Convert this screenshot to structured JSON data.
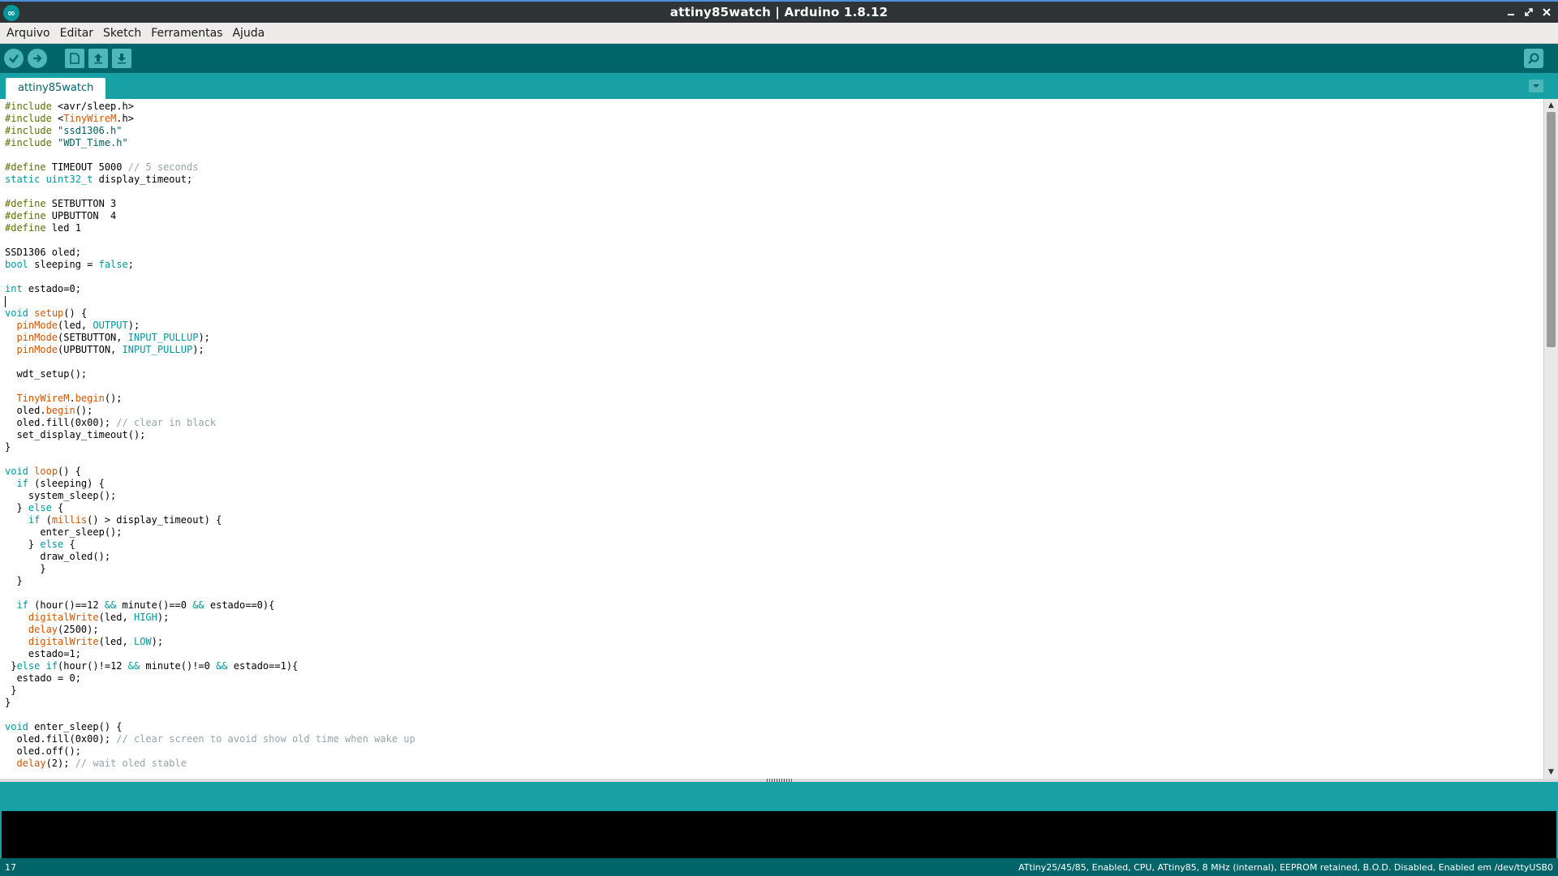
{
  "window": {
    "title": "attiny85watch | Arduino 1.8.12",
    "app_icon_label": "∞"
  },
  "menu": [
    "Arquivo",
    "Editar",
    "Sketch",
    "Ferramentas",
    "Ajuda"
  ],
  "toolbar": {
    "buttons": [
      "verify-icon",
      "upload-icon",
      "new-icon",
      "open-icon",
      "save-icon"
    ],
    "serial_monitor": "magnifier-icon"
  },
  "tabs": [
    {
      "label": "attiny85watch",
      "active": true
    }
  ],
  "editor": {
    "cursor_line": 17,
    "lines": [
      [
        [
          "p",
          "#include "
        ],
        [
          "n",
          "<avr/sleep.h>"
        ]
      ],
      [
        [
          "p",
          "#include "
        ],
        [
          "n",
          "<"
        ],
        [
          "f",
          "TinyWireM"
        ],
        [
          "n",
          ".h>"
        ]
      ],
      [
        [
          "p",
          "#include "
        ],
        [
          "s",
          "\"ssd1306.h\""
        ]
      ],
      [
        [
          "p",
          "#include "
        ],
        [
          "s",
          "\"WDT_Time.h\""
        ]
      ],
      [],
      [
        [
          "p",
          "#define "
        ],
        [
          "n",
          "TIMEOUT 5000 "
        ],
        [
          "c",
          "// 5 seconds"
        ]
      ],
      [
        [
          "k",
          "static "
        ],
        [
          "k",
          "uint32_t"
        ],
        [
          "n",
          " display_timeout;"
        ]
      ],
      [],
      [
        [
          "p",
          "#define "
        ],
        [
          "n",
          "SETBUTTON 3"
        ]
      ],
      [
        [
          "p",
          "#define "
        ],
        [
          "n",
          "UPBUTTON  4"
        ]
      ],
      [
        [
          "p",
          "#define "
        ],
        [
          "n",
          "led 1"
        ]
      ],
      [],
      [
        [
          "n",
          "SSD1306 oled;"
        ]
      ],
      [
        [
          "k",
          "bool"
        ],
        [
          "n",
          " sleeping = "
        ],
        [
          "k",
          "false"
        ],
        [
          "n",
          ";"
        ]
      ],
      [],
      [
        [
          "k",
          "int"
        ],
        [
          "n",
          " estado=0;"
        ]
      ],
      [],
      [
        [
          "k",
          "void"
        ],
        [
          "n",
          " "
        ],
        [
          "f",
          "setup"
        ],
        [
          "n",
          "() {"
        ]
      ],
      [
        [
          "n",
          "  "
        ],
        [
          "f",
          "pinMode"
        ],
        [
          "n",
          "(led, "
        ],
        [
          "k",
          "OUTPUT"
        ],
        [
          "n",
          ");"
        ]
      ],
      [
        [
          "n",
          "  "
        ],
        [
          "f",
          "pinMode"
        ],
        [
          "n",
          "(SETBUTTON, "
        ],
        [
          "k",
          "INPUT_PULLUP"
        ],
        [
          "n",
          ");"
        ]
      ],
      [
        [
          "n",
          "  "
        ],
        [
          "f",
          "pinMode"
        ],
        [
          "n",
          "(UPBUTTON, "
        ],
        [
          "k",
          "INPUT_PULLUP"
        ],
        [
          "n",
          ");"
        ]
      ],
      [],
      [
        [
          "n",
          "  wdt_setup();"
        ]
      ],
      [],
      [
        [
          "n",
          "  "
        ],
        [
          "f",
          "TinyWireM"
        ],
        [
          "n",
          "."
        ],
        [
          "f",
          "begin"
        ],
        [
          "n",
          "();"
        ]
      ],
      [
        [
          "n",
          "  oled."
        ],
        [
          "f",
          "begin"
        ],
        [
          "n",
          "();"
        ]
      ],
      [
        [
          "n",
          "  oled.fill(0x00); "
        ],
        [
          "c",
          "// clear in black"
        ]
      ],
      [
        [
          "n",
          "  set_display_timeout();"
        ]
      ],
      [
        [
          "n",
          "}"
        ]
      ],
      [],
      [
        [
          "k",
          "void"
        ],
        [
          "n",
          " "
        ],
        [
          "f",
          "loop"
        ],
        [
          "n",
          "() {"
        ]
      ],
      [
        [
          "n",
          "  "
        ],
        [
          "k",
          "if"
        ],
        [
          "n",
          " (sleeping) {"
        ]
      ],
      [
        [
          "n",
          "    system_sleep();"
        ]
      ],
      [
        [
          "n",
          "  } "
        ],
        [
          "k",
          "else"
        ],
        [
          "n",
          " {"
        ]
      ],
      [
        [
          "n",
          "    "
        ],
        [
          "k",
          "if"
        ],
        [
          "n",
          " ("
        ],
        [
          "f",
          "millis"
        ],
        [
          "n",
          "() > display_timeout) {"
        ]
      ],
      [
        [
          "n",
          "      enter_sleep();"
        ]
      ],
      [
        [
          "n",
          "    } "
        ],
        [
          "k",
          "else"
        ],
        [
          "n",
          " {"
        ]
      ],
      [
        [
          "n",
          "      draw_oled();"
        ]
      ],
      [
        [
          "n",
          "      }"
        ]
      ],
      [
        [
          "n",
          "  }"
        ]
      ],
      [],
      [
        [
          "n",
          "  "
        ],
        [
          "k",
          "if"
        ],
        [
          "n",
          " (hour()==12 "
        ],
        [
          "k",
          "&&"
        ],
        [
          "n",
          " minute()==0 "
        ],
        [
          "k",
          "&&"
        ],
        [
          "n",
          " estado==0){"
        ]
      ],
      [
        [
          "n",
          "    "
        ],
        [
          "f",
          "digitalWrite"
        ],
        [
          "n",
          "(led, "
        ],
        [
          "k",
          "HIGH"
        ],
        [
          "n",
          ");"
        ]
      ],
      [
        [
          "n",
          "    "
        ],
        [
          "f",
          "delay"
        ],
        [
          "n",
          "(2500);"
        ]
      ],
      [
        [
          "n",
          "    "
        ],
        [
          "f",
          "digitalWrite"
        ],
        [
          "n",
          "(led, "
        ],
        [
          "k",
          "LOW"
        ],
        [
          "n",
          ");"
        ]
      ],
      [
        [
          "n",
          "    estado=1;"
        ]
      ],
      [
        [
          "n",
          " }"
        ],
        [
          "k",
          "else"
        ],
        [
          "n",
          " "
        ],
        [
          "k",
          "if"
        ],
        [
          "n",
          "(hour()!=12 "
        ],
        [
          "k",
          "&&"
        ],
        [
          "n",
          " minute()!=0 "
        ],
        [
          "k",
          "&&"
        ],
        [
          "n",
          " estado==1){"
        ]
      ],
      [
        [
          "n",
          "  estado = 0;"
        ]
      ],
      [
        [
          "n",
          " }"
        ]
      ],
      [
        [
          "n",
          "}"
        ]
      ],
      [],
      [
        [
          "k",
          "void"
        ],
        [
          "n",
          " enter_sleep() {"
        ]
      ],
      [
        [
          "n",
          "  oled.fill(0x00); "
        ],
        [
          "c",
          "// clear screen to avoid show old time when wake up"
        ]
      ],
      [
        [
          "n",
          "  oled.off();"
        ]
      ],
      [
        [
          "n",
          "  "
        ],
        [
          "f",
          "delay"
        ],
        [
          "n",
          "(2); "
        ],
        [
          "c",
          "// wait oled stable"
        ]
      ]
    ]
  },
  "status": {
    "line_number": "17",
    "board_info": "ATtiny25/45/85, Enabled, CPU, ATtiny85, 8 MHz (internal), EEPROM retained, B.O.D. Disabled, Enabled em /dev/ttyUSB0"
  },
  "colors": {
    "teal_dark": "#006468",
    "teal": "#17a1a5",
    "keyword": "#00979c",
    "function": "#d35400",
    "comment": "#95a5a6"
  }
}
